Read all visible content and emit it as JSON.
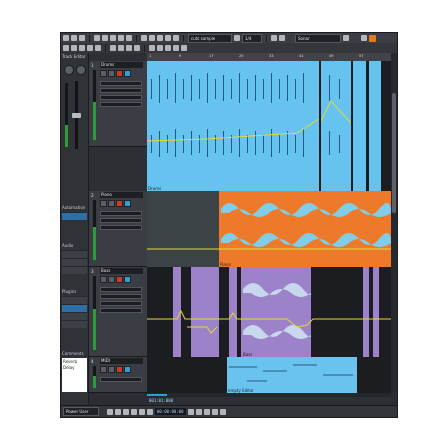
{
  "toolbar": {
    "zoom_value": "cuts sample",
    "grid_value": "1/4",
    "search_placeholder": "Sonar"
  },
  "inspector": {
    "title": "Track Editor",
    "labels": [
      "Automation",
      "Audio",
      "Plugins",
      "Comments"
    ],
    "comment_lines": [
      "Reverb",
      "Delay"
    ]
  },
  "tracks": [
    {
      "number": "1",
      "name": "Drums"
    },
    {
      "number": "2",
      "name": "Piano"
    },
    {
      "number": "3",
      "name": "Bass"
    },
    {
      "number": "4",
      "name": "MIDI"
    }
  ],
  "ruler": {
    "ticks": [
      "1",
      "9",
      "17",
      "25",
      "33",
      "41",
      "49",
      "57"
    ]
  },
  "events": {
    "drums_label": "Drums",
    "piano_label": "Piano",
    "bass_label": "Bass",
    "midi_label": "empty Editor"
  },
  "transport": {
    "mode_value": "Power User",
    "position": "001:01:000",
    "time": "00:00:00:00"
  },
  "colors": {
    "drums": "#66c2ef",
    "piano": "#ec7a2a",
    "bass": "#9b82c9",
    "midi": "#6ac3ef",
    "automation": "#e3d83a"
  }
}
